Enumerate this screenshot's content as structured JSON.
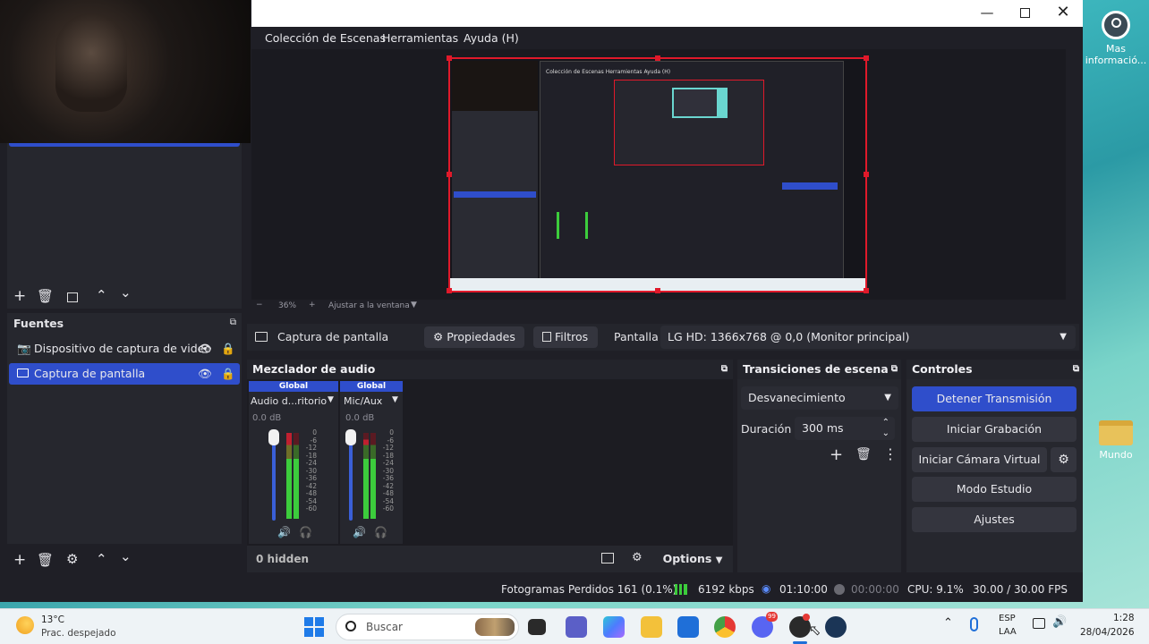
{
  "menu": {
    "items": [
      "Colección de Escenas",
      "Herramientas",
      "Ayuda (H)"
    ]
  },
  "desktop": {
    "icon1_label": "Mas\ninformació...",
    "icon2_label": "Mundo"
  },
  "preview": {
    "zoom": "36%",
    "fit_label": "Ajustar a la ventana",
    "inner_menu": "Colección de Escenas  Herramientas  Ayuda (H)"
  },
  "sources": {
    "header": "Fuentes",
    "items": [
      "Dispositivo de captura de video",
      "Captura de pantalla"
    ]
  },
  "properties_bar": {
    "source_name": "Captura de pantalla",
    "properties": "Propiedades",
    "filters": "Filtros",
    "screen_label": "Pantalla",
    "screen_value": "LG HD: 1366x768 @ 0,0 (Monitor principal)"
  },
  "mixer": {
    "header": "Mezclador de audio",
    "channels": [
      {
        "group": "Global",
        "name": "Audio d...ritorio",
        "db": "0.0 dB"
      },
      {
        "group": "Global",
        "name": "Mic/Aux",
        "db": "0.0 dB"
      }
    ],
    "scale": [
      "0",
      "-6",
      "-12",
      "-18",
      "-24",
      "-30",
      "-36",
      "-42",
      "-48",
      "-54",
      "-60"
    ],
    "hidden": "0 hidden",
    "options": "Options"
  },
  "transitions": {
    "header": "Transiciones de escena",
    "selected": "Desvanecimiento",
    "duration_label": "Duración",
    "duration_value": "300 ms"
  },
  "controls": {
    "header": "Controles",
    "buttons": [
      "Detener Transmisión",
      "Iniciar Grabación",
      "Iniciar Cámara Virtual",
      "Modo Estudio",
      "Ajustes"
    ]
  },
  "status": {
    "dropped": "Fotogramas Perdidos 161 (0.1%)",
    "bitrate": "6192 kbps",
    "stream_time": "01:10:00",
    "rec_time": "00:00:00",
    "cpu": "CPU: 9.1%",
    "fps": "30.00 / 30.00 FPS"
  },
  "taskbar": {
    "weather_temp": "13°C",
    "weather_desc": "Prac. despejado",
    "search_placeholder": "Buscar",
    "lang1": "ESP",
    "lang2": "LAA",
    "time": "1:28",
    "date": "28/04/2026",
    "discord_badge": "99"
  },
  "colors": {
    "accent": "#2f4ecb",
    "selection_border": "#e0192a",
    "meter_green": "#3ccc3c",
    "meter_red": "#c02030"
  }
}
